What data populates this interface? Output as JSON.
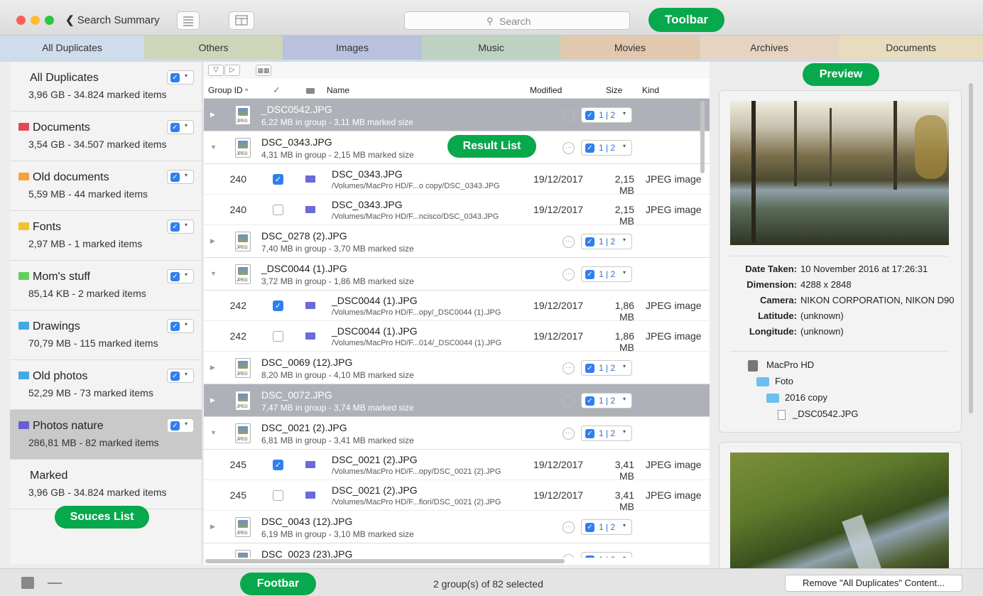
{
  "toolbar": {
    "back_label": "Search Summary",
    "search_placeholder": "Search",
    "annotation": "Toolbar"
  },
  "tabs": [
    {
      "label": "All Duplicates",
      "color": "#cfdceb"
    },
    {
      "label": "Others",
      "color": "#cdd6b9"
    },
    {
      "label": "Images",
      "color": "#b9c1dd"
    },
    {
      "label": "Music",
      "color": "#bdd2c1"
    },
    {
      "label": "Movies",
      "color": "#e1c8ae"
    },
    {
      "label": "Archives",
      "color": "#e6d3c1"
    },
    {
      "label": "Documents",
      "color": "#e7dcbe"
    }
  ],
  "sources": {
    "annotation": "Souces List",
    "items": [
      {
        "name": "All Duplicates",
        "sub": "3,96 GB - 34.824 marked items",
        "folder_color": "",
        "checked": true
      },
      {
        "name": "Documents",
        "sub": "3,54 GB - 34.507 marked items",
        "folder_color": "#e2485a",
        "checked": true
      },
      {
        "name": "Old documents",
        "sub": "5,59 MB - 44 marked items",
        "folder_color": "#f5a23c",
        "checked": true
      },
      {
        "name": "Fonts",
        "sub": "2,97 MB - 1 marked items",
        "folder_color": "#f1c232",
        "checked": true
      },
      {
        "name": "Mom's stuff",
        "sub": "85,14 KB - 2 marked items",
        "folder_color": "#5fd15b",
        "checked": true
      },
      {
        "name": "Drawings",
        "sub": "70,79 MB - 115 marked items",
        "folder_color": "#41a9e4",
        "checked": true
      },
      {
        "name": "Old photos",
        "sub": "52,29 MB - 73 marked items",
        "folder_color": "#41a9e4",
        "checked": true
      },
      {
        "name": "Photos nature",
        "sub": "286,81 MB - 82 marked items",
        "folder_color": "#6a5fd0",
        "checked": true
      },
      {
        "name": "Marked",
        "sub": "3,96 GB - 34.824 marked items",
        "folder_color": "",
        "checked": false
      }
    ]
  },
  "result_list": {
    "annotation": "Result List",
    "columns": {
      "group_id": "Group ID",
      "check": "✓",
      "name": "Name",
      "modified": "Modified",
      "size": "Size",
      "kind": "Kind"
    },
    "rows": [
      {
        "type": "group",
        "name": "_DSC0542.JPG",
        "sub": "6,22 MB in group - 3,11 MB marked size",
        "count": "1 | 2",
        "selected": true,
        "expanded": false
      },
      {
        "type": "group",
        "name": "DSC_0343.JPG",
        "sub": "4,31 MB in group - 2,15 MB marked size",
        "count": "1 | 2",
        "selected": false,
        "expanded": true
      },
      {
        "type": "file",
        "id": "240",
        "checked": true,
        "name": "DSC_0343.JPG",
        "path": "/Volumes/MacPro HD/F...o copy/DSC_0343.JPG",
        "modified": "19/12/2017",
        "size": "2,15 MB",
        "kind": "JPEG image"
      },
      {
        "type": "file",
        "id": "240",
        "checked": false,
        "name": "DSC_0343.JPG",
        "path": "/Volumes/MacPro HD/F...ncisco/DSC_0343.JPG",
        "modified": "19/12/2017",
        "size": "2,15 MB",
        "kind": "JPEG image"
      },
      {
        "type": "group",
        "name": "DSC_0278 (2).JPG",
        "sub": "7,40 MB in group - 3,70 MB marked size",
        "count": "1 | 2",
        "selected": false,
        "expanded": false
      },
      {
        "type": "group",
        "name": "_DSC0044 (1).JPG",
        "sub": "3,72 MB in group - 1,86 MB marked size",
        "count": "1 | 2",
        "selected": false,
        "expanded": true
      },
      {
        "type": "file",
        "id": "242",
        "checked": true,
        "name": "_DSC0044 (1).JPG",
        "path": "/Volumes/MacPro HD/F...opy/_DSC0044 (1).JPG",
        "modified": "19/12/2017",
        "size": "1,86 MB",
        "kind": "JPEG image"
      },
      {
        "type": "file",
        "id": "242",
        "checked": false,
        "name": "_DSC0044 (1).JPG",
        "path": "/Volumes/MacPro HD/F...014/_DSC0044 (1).JPG",
        "modified": "19/12/2017",
        "size": "1,86 MB",
        "kind": "JPEG image"
      },
      {
        "type": "group",
        "name": "DSC_0069 (12).JPG",
        "sub": "8,20 MB in group - 4,10 MB marked size",
        "count": "1 | 2",
        "selected": false,
        "expanded": false
      },
      {
        "type": "group",
        "name": "DSC_0072.JPG",
        "sub": "7,47 MB in group - 3,74 MB marked size",
        "count": "1 | 2",
        "selected": true,
        "expanded": false
      },
      {
        "type": "group",
        "name": "DSC_0021 (2).JPG",
        "sub": "6,81 MB in group - 3,41 MB marked size",
        "count": "1 | 2",
        "selected": false,
        "expanded": true
      },
      {
        "type": "file",
        "id": "245",
        "checked": true,
        "name": "DSC_0021 (2).JPG",
        "path": "/Volumes/MacPro HD/F...opy/DSC_0021 (2).JPG",
        "modified": "19/12/2017",
        "size": "3,41 MB",
        "kind": "JPEG image"
      },
      {
        "type": "file",
        "id": "245",
        "checked": false,
        "name": "DSC_0021 (2).JPG",
        "path": "/Volumes/MacPro HD/F...fiori/DSC_0021 (2).JPG",
        "modified": "19/12/2017",
        "size": "3,41 MB",
        "kind": "JPEG image"
      },
      {
        "type": "group",
        "name": "DSC_0043 (12).JPG",
        "sub": "6,19 MB in group - 3,10 MB marked size",
        "count": "1 | 2",
        "selected": false,
        "expanded": false
      },
      {
        "type": "group",
        "name": "DSC_0023 (23).JPG",
        "sub": "",
        "count": "1 | 2",
        "selected": false,
        "expanded": false
      }
    ]
  },
  "preview": {
    "annotation": "Preview",
    "meta": [
      {
        "k": "Date Taken:",
        "v": "10 November 2016 at 17:26:31"
      },
      {
        "k": "Dimension:",
        "v": "4288 x 2848"
      },
      {
        "k": "Camera:",
        "v": "NIKON CORPORATION, NIKON D90"
      },
      {
        "k": "Latitude:",
        "v": "(unknown)"
      },
      {
        "k": "Longitude:",
        "v": "(unknown)"
      }
    ],
    "path": [
      {
        "label": "MacPro HD",
        "icon": "drive-icon"
      },
      {
        "label": "Foto",
        "icon": "folder-icon"
      },
      {
        "label": "2016 copy",
        "icon": "folder-icon"
      },
      {
        "label": "_DSC0542.JPG",
        "icon": "file-icon"
      }
    ]
  },
  "footbar": {
    "annotation": "Footbar",
    "status": "2 group(s) of 82 selected",
    "remove_label": "Remove \"All Duplicates\" Content..."
  }
}
